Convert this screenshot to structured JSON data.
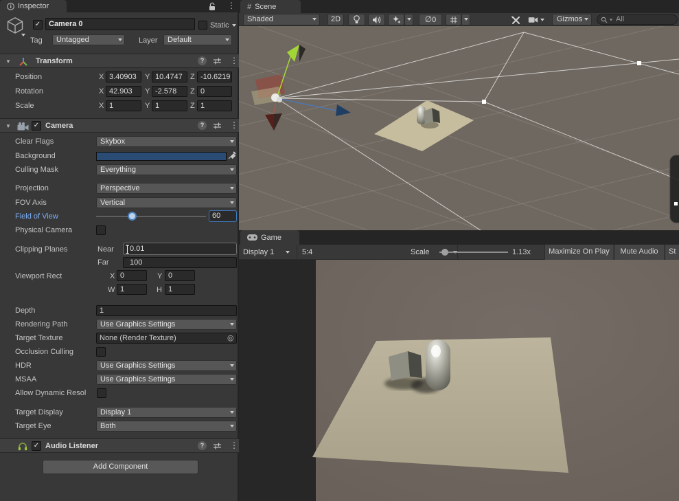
{
  "icons": {
    "checkmark": "✓",
    "kebab": "⋮",
    "foldout_open": "▼",
    "help": "?",
    "picker": "◎",
    "empty_set": "∅",
    "hash": "#",
    "info": "i"
  },
  "inspector": {
    "tab_label": "Inspector",
    "gameobject": {
      "name": "Camera 0",
      "static_label": "Static",
      "tag_label": "Tag",
      "tag_value": "Untagged",
      "layer_label": "Layer",
      "layer_value": "Default"
    },
    "transform": {
      "title": "Transform",
      "axis_x": "X",
      "axis_y": "Y",
      "axis_z": "Z",
      "rows": [
        {
          "label": "Position",
          "x": "3.40903",
          "y": "10.4747",
          "z": "-10.6219"
        },
        {
          "label": "Rotation",
          "x": "42.903",
          "y": "-2.578",
          "z": "0"
        },
        {
          "label": "Scale",
          "x": "1",
          "y": "1",
          "z": "1"
        }
      ]
    },
    "camera": {
      "title": "Camera",
      "clear_flags_label": "Clear Flags",
      "clear_flags_value": "Skybox",
      "background_label": "Background",
      "culling_mask_label": "Culling Mask",
      "culling_mask_value": "Everything",
      "projection_label": "Projection",
      "projection_value": "Perspective",
      "fov_axis_label": "FOV Axis",
      "fov_axis_value": "Vertical",
      "fov_label": "Field of View",
      "fov_value": "60",
      "physical_label": "Physical Camera",
      "clipping_label": "Clipping Planes",
      "near_label": "Near",
      "near_value": "0.01",
      "far_label": "Far",
      "far_value": "100",
      "viewport_label": "Viewport Rect",
      "vx_label": "X",
      "vx": "0",
      "vy_label": "Y",
      "vy": "0",
      "vw_label": "W",
      "vw": "1",
      "vh_label": "H",
      "vh": "1",
      "depth_label": "Depth",
      "depth_value": "1",
      "rendering_path_label": "Rendering Path",
      "rendering_path_value": "Use Graphics Settings",
      "target_texture_label": "Target Texture",
      "target_texture_value": "None (Render Texture)",
      "occlusion_label": "Occlusion Culling",
      "hdr_label": "HDR",
      "hdr_value": "Use Graphics Settings",
      "msaa_label": "MSAA",
      "msaa_value": "Use Graphics Settings",
      "dynamic_res_label": "Allow Dynamic Resol",
      "target_display_label": "Target Display",
      "target_display_value": "Display 1",
      "target_eye_label": "Target Eye",
      "target_eye_value": "Both"
    },
    "audio_listener": {
      "title": "Audio Listener"
    },
    "add_component_label": "Add Component"
  },
  "scene": {
    "tab_label": "Scene",
    "toolbar": {
      "draw_mode": "Shaded",
      "btn_2d": "2D",
      "hidden_count": "0",
      "gizmos_label": "Gizmos",
      "search_value": "All"
    }
  },
  "game": {
    "tab_label": "Game",
    "toolbar": {
      "display": "Display 1",
      "aspect": "5:4",
      "scale_label": "Scale",
      "scale_value": "1.13x",
      "maximize_label": "Maximize On Play",
      "mute_label": "Mute Audio",
      "stats_label": "St"
    }
  },
  "colors": {
    "focus_blue": "#3E7BBF",
    "fov_label_blue": "#7CAEF5",
    "background_swatch": "#2A4B74",
    "scene_viewport_bg": "#6F6860",
    "game_viewport_bg": "#6F6660"
  }
}
